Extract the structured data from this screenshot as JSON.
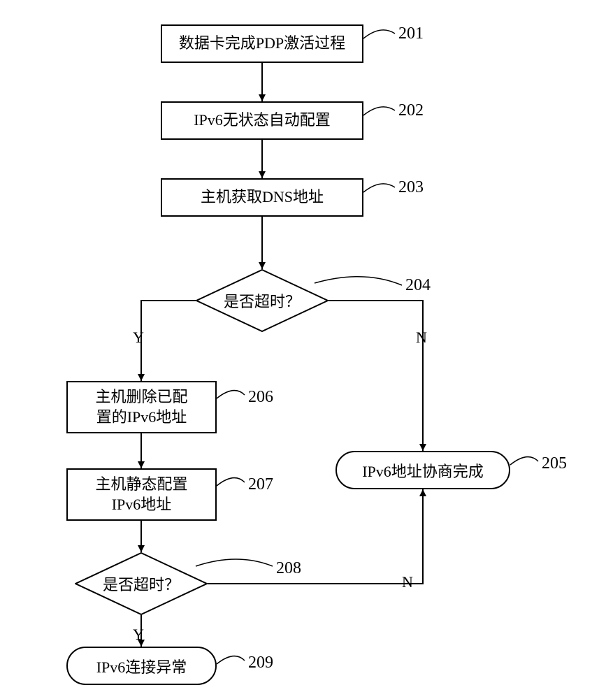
{
  "steps": {
    "s201": {
      "text": "数据卡完成PDP激活过程",
      "num": "201"
    },
    "s202": {
      "text": "IPv6无状态自动配置",
      "num": "202"
    },
    "s203": {
      "text": "主机获取DNS地址",
      "num": "203"
    },
    "s204": {
      "text": "是否超时？",
      "num": "204"
    },
    "s205": {
      "text": "IPv6地址协商完成",
      "num": "205"
    },
    "s206": {
      "text": "主机删除已配\n置的IPv6地址",
      "num": "206"
    },
    "s207": {
      "text": "主机静态配置\nIPv6地址",
      "num": "207"
    },
    "s208": {
      "text": "是否超时？",
      "num": "208"
    },
    "s209": {
      "text": "IPv6连接异常",
      "num": "209"
    }
  },
  "branches": {
    "y1": "Y",
    "n1": "N",
    "y2": "Y",
    "n2": "N"
  }
}
